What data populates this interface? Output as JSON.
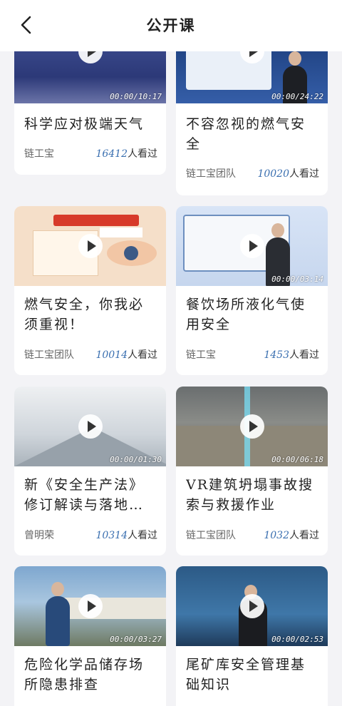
{
  "header": {
    "title": "公开课",
    "back_icon": "chevron-left-icon"
  },
  "courses": [
    {
      "title": "科学应对极端天气",
      "author": "链工宝",
      "views": "16412",
      "views_suffix": "人看过",
      "duration": "00:00/10:17"
    },
    {
      "title": "不容忽视的燃气安全",
      "author": "链工宝团队",
      "views": "10020",
      "views_suffix": "人看过",
      "duration": "00:00/24:22"
    },
    {
      "title": "燃气安全，你我必须重视！",
      "author": "链工宝团队",
      "views": "10014",
      "views_suffix": "人看过",
      "duration": ""
    },
    {
      "title": "餐饮场所液化气使用安全",
      "author": "链工宝",
      "views": "1453",
      "views_suffix": "人看过",
      "duration": "00:00/03:14"
    },
    {
      "title": "新《安全生产法》修订解读与落地…",
      "author": "曾明荣",
      "views": "10314",
      "views_suffix": "人看过",
      "duration": "00:00/01:30"
    },
    {
      "title": "VR建筑坍塌事故搜索与救援作业",
      "author": "链工宝团队",
      "views": "1032",
      "views_suffix": "人看过",
      "duration": "00:00/06:18"
    },
    {
      "title": "危险化学品储存场所隐患排查",
      "author": "",
      "views": "",
      "views_suffix": "",
      "duration": "00:00/03:27"
    },
    {
      "title": "尾矿库安全管理基础知识",
      "author": "",
      "views": "",
      "views_suffix": "",
      "duration": "00:00/02:53"
    }
  ]
}
